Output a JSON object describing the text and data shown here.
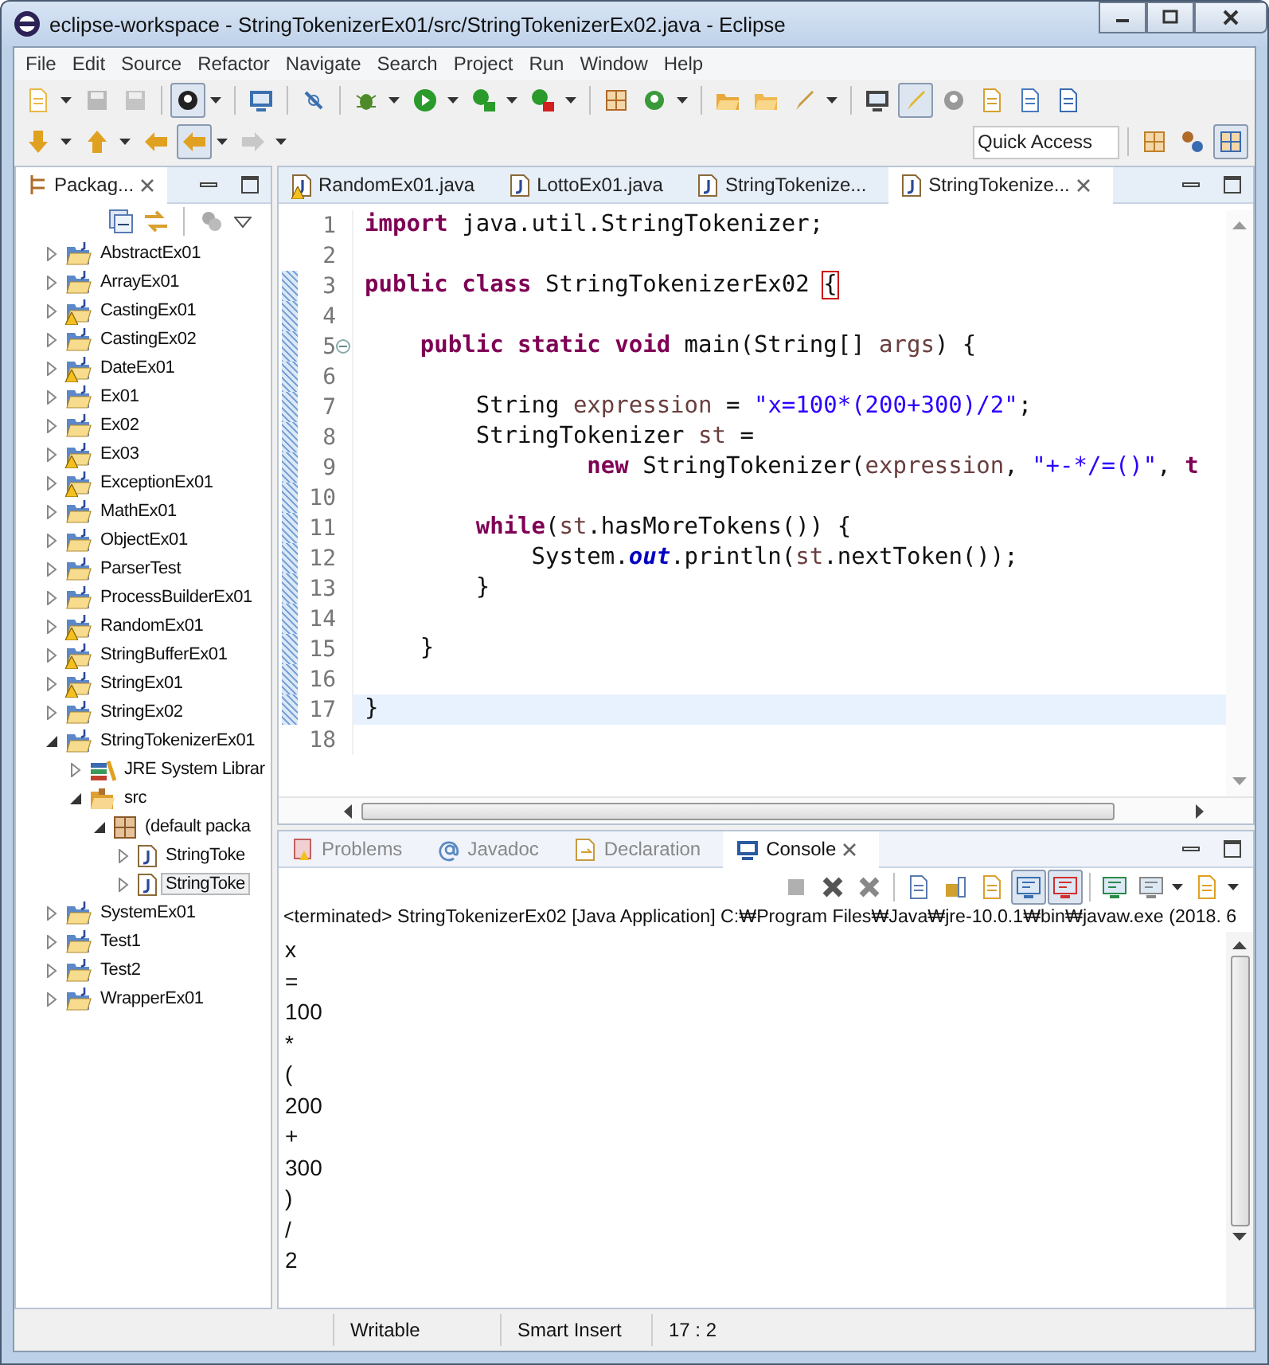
{
  "window": {
    "title": "eclipse-workspace - StringTokenizerEx01/src/StringTokenizerEx02.java - Eclipse"
  },
  "menu": [
    "File",
    "Edit",
    "Source",
    "Refactor",
    "Navigate",
    "Search",
    "Project",
    "Run",
    "Window",
    "Help"
  ],
  "quick_access": {
    "placeholder": "Quick Access"
  },
  "package_explorer": {
    "tab": {
      "label": "Packag...",
      "selected": true
    },
    "tree": [
      {
        "label": "AbstractEx01",
        "kind": "project",
        "warning": false,
        "expanded": false,
        "selected": false
      },
      {
        "label": "ArrayEx01",
        "kind": "project",
        "warning": false,
        "expanded": false,
        "selected": false
      },
      {
        "label": "CastingEx01",
        "kind": "project",
        "warning": true,
        "expanded": false,
        "selected": false
      },
      {
        "label": "CastingEx02",
        "kind": "project",
        "warning": false,
        "expanded": false,
        "selected": false
      },
      {
        "label": "DateEx01",
        "kind": "project",
        "warning": true,
        "expanded": false,
        "selected": false
      },
      {
        "label": "Ex01",
        "kind": "project",
        "warning": false,
        "expanded": false,
        "selected": false
      },
      {
        "label": "Ex02",
        "kind": "project",
        "warning": false,
        "expanded": false,
        "selected": false
      },
      {
        "label": "Ex03",
        "kind": "project",
        "warning": true,
        "expanded": false,
        "selected": false
      },
      {
        "label": "ExceptionEx01",
        "kind": "project",
        "warning": true,
        "expanded": false,
        "selected": false
      },
      {
        "label": "MathEx01",
        "kind": "project",
        "warning": false,
        "expanded": false,
        "selected": false
      },
      {
        "label": "ObjectEx01",
        "kind": "project",
        "warning": false,
        "expanded": false,
        "selected": false
      },
      {
        "label": "ParserTest",
        "kind": "project",
        "warning": false,
        "expanded": false,
        "selected": false
      },
      {
        "label": "ProcessBuilderEx01",
        "kind": "project",
        "warning": false,
        "expanded": false,
        "selected": false
      },
      {
        "label": "RandomEx01",
        "kind": "project",
        "warning": true,
        "expanded": false,
        "selected": false
      },
      {
        "label": "StringBufferEx01",
        "kind": "project",
        "warning": true,
        "expanded": false,
        "selected": false
      },
      {
        "label": "StringEx01",
        "kind": "project",
        "warning": true,
        "expanded": false,
        "selected": false
      },
      {
        "label": "StringEx02",
        "kind": "project",
        "warning": false,
        "expanded": false,
        "selected": false
      },
      {
        "label": "StringTokenizerEx01",
        "kind": "project",
        "warning": false,
        "expanded": true,
        "selected": false,
        "children": [
          {
            "label": "JRE System Librar",
            "kind": "library",
            "warning": false,
            "expanded": false,
            "selected": false
          },
          {
            "label": "src",
            "kind": "source_folder",
            "warning": false,
            "expanded": true,
            "selected": false,
            "children": [
              {
                "label": "(default packa",
                "kind": "package",
                "warning": false,
                "expanded": true,
                "selected": false,
                "children": [
                  {
                    "label": "StringToke",
                    "kind": "file",
                    "warning": false,
                    "expanded": false,
                    "selected": false
                  },
                  {
                    "label": "StringToke",
                    "kind": "file",
                    "warning": false,
                    "expanded": false,
                    "selected": true
                  }
                ]
              }
            ]
          }
        ]
      },
      {
        "label": "SystemEx01",
        "kind": "project",
        "warning": false,
        "expanded": false,
        "selected": false
      },
      {
        "label": "Test1",
        "kind": "project",
        "warning": false,
        "expanded": false,
        "selected": false
      },
      {
        "label": "Test2",
        "kind": "project",
        "warning": false,
        "expanded": false,
        "selected": false
      },
      {
        "label": "WrapperEx01",
        "kind": "project",
        "warning": false,
        "expanded": false,
        "selected": false
      }
    ]
  },
  "editor": {
    "tabs": [
      {
        "label": "RandomEx01.java",
        "warning": true,
        "selected": false
      },
      {
        "label": "LottoEx01.java",
        "warning": false,
        "selected": false
      },
      {
        "label": "StringTokenize...",
        "warning": false,
        "selected": false
      },
      {
        "label": "StringTokenize...",
        "warning": false,
        "selected": true
      }
    ],
    "lines": [
      {
        "number": "1",
        "changed": false,
        "current": false,
        "foldable": false,
        "tokens": [
          {
            "kind": "keyword",
            "text": "import"
          },
          {
            "kind": "plain",
            "text": " java.util.StringTokenizer;"
          }
        ]
      },
      {
        "number": "2",
        "changed": false,
        "current": false,
        "foldable": false
      },
      {
        "number": "3",
        "changed": true,
        "current": false,
        "foldable": false,
        "tokens": [
          {
            "kind": "keyword",
            "text": "public class"
          },
          {
            "kind": "plain",
            "text": " StringTokenizerEx02 "
          },
          {
            "kind": "bracket_match",
            "text": "{"
          }
        ]
      },
      {
        "number": "4",
        "changed": true,
        "current": false,
        "foldable": false
      },
      {
        "number": "5",
        "changed": true,
        "current": false,
        "foldable": true,
        "tokens": [
          {
            "kind": "keyword",
            "text": "    public static void"
          },
          {
            "kind": "plain",
            "text": " main(String[] "
          },
          {
            "kind": "variable",
            "text": "args"
          },
          {
            "kind": "plain",
            "text": ") {"
          }
        ]
      },
      {
        "number": "6",
        "changed": true,
        "current": false,
        "foldable": false
      },
      {
        "number": "7",
        "changed": true,
        "current": false,
        "foldable": false,
        "tokens": [
          {
            "kind": "plain",
            "text": "        String "
          },
          {
            "kind": "variable",
            "text": "expression"
          },
          {
            "kind": "plain",
            "text": " = "
          },
          {
            "kind": "string",
            "text": "\"x=100*(200+300)/2\""
          },
          {
            "kind": "plain",
            "text": ";"
          }
        ]
      },
      {
        "number": "8",
        "changed": true,
        "current": false,
        "foldable": false,
        "tokens": [
          {
            "kind": "plain",
            "text": "        StringTokenizer "
          },
          {
            "kind": "variable",
            "text": "st"
          },
          {
            "kind": "plain",
            "text": " ="
          }
        ]
      },
      {
        "number": "9",
        "changed": true,
        "current": false,
        "foldable": false,
        "tokens": [
          {
            "kind": "keyword",
            "text": "                new"
          },
          {
            "kind": "plain",
            "text": " StringTokenizer("
          },
          {
            "kind": "variable",
            "text": "expression"
          },
          {
            "kind": "plain",
            "text": ", "
          },
          {
            "kind": "string",
            "text": "\"+-*/=()\""
          },
          {
            "kind": "plain",
            "text": ", "
          },
          {
            "kind": "keyword",
            "text": "t"
          }
        ]
      },
      {
        "number": "10",
        "changed": true,
        "current": false,
        "foldable": false
      },
      {
        "number": "11",
        "changed": true,
        "current": false,
        "foldable": false,
        "tokens": [
          {
            "kind": "keyword",
            "text": "        while"
          },
          {
            "kind": "plain",
            "text": "("
          },
          {
            "kind": "variable",
            "text": "st"
          },
          {
            "kind": "plain",
            "text": ".hasMoreTokens()) {"
          }
        ]
      },
      {
        "number": "12",
        "changed": true,
        "current": false,
        "foldable": false,
        "tokens": [
          {
            "kind": "plain",
            "text": "            System."
          },
          {
            "kind": "static_field",
            "text": "out"
          },
          {
            "kind": "plain",
            "text": ".println("
          },
          {
            "kind": "variable",
            "text": "st"
          },
          {
            "kind": "plain",
            "text": ".nextToken());"
          }
        ]
      },
      {
        "number": "13",
        "changed": true,
        "current": false,
        "foldable": false,
        "tokens": [
          {
            "kind": "plain",
            "text": "        }"
          }
        ]
      },
      {
        "number": "14",
        "changed": true,
        "current": false,
        "foldable": false
      },
      {
        "number": "15",
        "changed": true,
        "current": false,
        "foldable": false,
        "tokens": [
          {
            "kind": "plain",
            "text": "    }"
          }
        ]
      },
      {
        "number": "16",
        "changed": true,
        "current": false,
        "foldable": false
      },
      {
        "number": "17",
        "changed": true,
        "current": true,
        "foldable": false,
        "tokens": [
          {
            "kind": "plain",
            "text": "}"
          }
        ]
      },
      {
        "number": "18",
        "changed": false,
        "current": false,
        "foldable": false
      }
    ]
  },
  "bottom_panel": {
    "tabs": [
      {
        "label": "Problems",
        "kind": "problems",
        "selected": false
      },
      {
        "label": "Javadoc",
        "kind": "javadoc",
        "selected": false
      },
      {
        "label": "Declaration",
        "kind": "declaration",
        "selected": false
      },
      {
        "label": "Console",
        "kind": "console",
        "selected": true
      }
    ],
    "console_header": "<terminated> StringTokenizerEx02 [Java Application] C:₩Program Files₩Java₩jre-10.0.1₩bin₩javaw.exe (2018. 6",
    "output": [
      "x",
      "=",
      "100",
      "*",
      "(",
      "200",
      "+",
      "300",
      ")",
      "/",
      "2"
    ]
  },
  "status_bar": [
    "Writable",
    "Smart Insert",
    "17 : 2"
  ]
}
